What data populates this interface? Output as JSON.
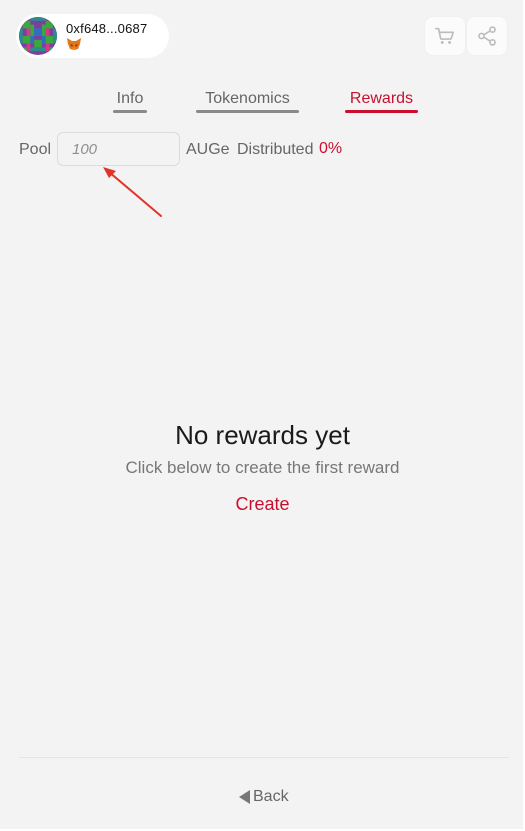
{
  "account": {
    "address": "0xf648...0687",
    "avatar_icon": "pixel-identicon",
    "wallet_icon": "metamask-fox-icon"
  },
  "header": {
    "cart_icon": "cart-icon",
    "share_icon": "share-icon"
  },
  "tabs": [
    {
      "label": "Info",
      "active": false
    },
    {
      "label": "Tokenomics",
      "active": false
    },
    {
      "label": "Rewards",
      "active": true
    }
  ],
  "pool": {
    "label": "Pool",
    "input_placeholder": "100",
    "input_value": "",
    "unit": "AUGe",
    "distributed_label": "Distributed",
    "distributed_value": "0%"
  },
  "empty_state": {
    "title": "No rewards yet",
    "subtitle": "Click below to create the first reward",
    "create_label": "Create"
  },
  "footer": {
    "back_label": "Back"
  },
  "colors": {
    "accent": "#c8102e",
    "background": "#f3f3f3",
    "muted_text": "#666666"
  }
}
